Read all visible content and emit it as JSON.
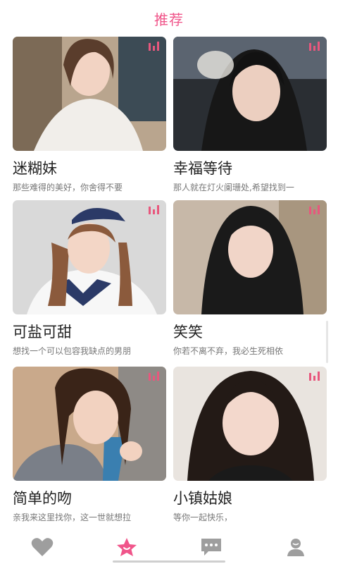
{
  "header": {
    "title": "推荐"
  },
  "cards": [
    {
      "name": "迷糊妹",
      "desc": "那些难得的美好，你舍得不要"
    },
    {
      "name": "幸福等待",
      "desc": "那人就在灯火阑珊处,希望找到一"
    },
    {
      "name": "可盐可甜",
      "desc": "想找一个可以包容我缺点的男朋"
    },
    {
      "name": "笑笑",
      "desc": "你若不离不弃，我必生死相依"
    },
    {
      "name": "简单的吻",
      "desc": "亲我来这里找你，这一世就想拉"
    },
    {
      "name": "小镇姑娘",
      "desc": "等你一起快乐，"
    }
  ],
  "tabbar": {
    "items": [
      {
        "icon": "heart-icon",
        "active": false
      },
      {
        "icon": "star-icon",
        "active": true
      },
      {
        "icon": "chat-icon",
        "active": false
      },
      {
        "icon": "profile-icon",
        "active": false
      }
    ]
  },
  "colors": {
    "accent": "#f0558a",
    "inactive_icon": "#9e9e9e",
    "badge": "#e8577d"
  }
}
